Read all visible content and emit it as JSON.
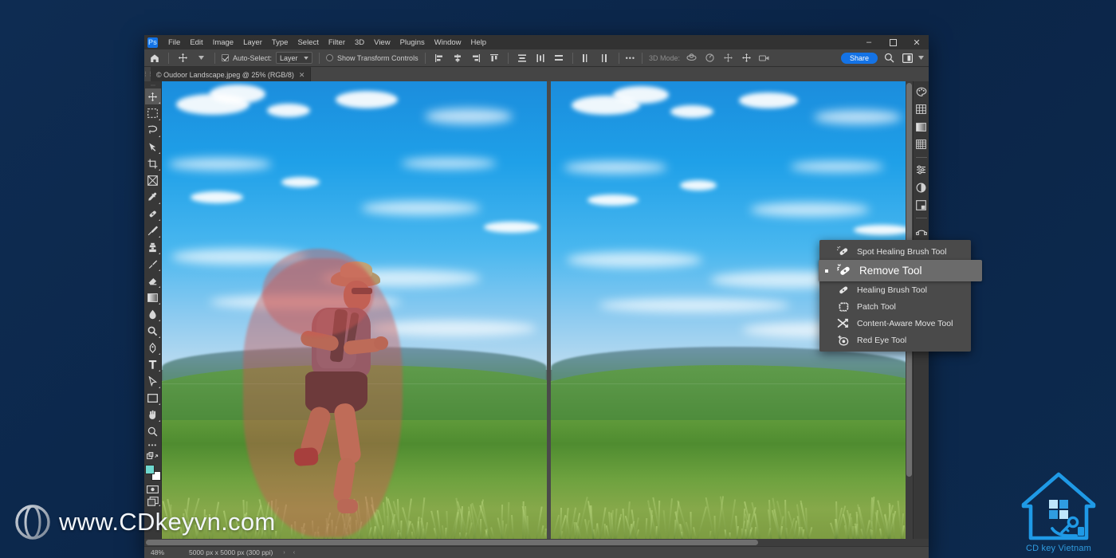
{
  "app": {
    "name": "Adobe Photoshop",
    "logo_text": "Ps"
  },
  "menubar": {
    "items": [
      "File",
      "Edit",
      "Image",
      "Layer",
      "Type",
      "Select",
      "Filter",
      "3D",
      "View",
      "Plugins",
      "Window",
      "Help"
    ],
    "window_controls": {
      "minimize": "–",
      "restore": "❐",
      "close": "✕"
    }
  },
  "optionsbar": {
    "home_icon": "home-icon",
    "tool_preset_icon": "move-tool-icon",
    "auto_select_label": "Auto-Select:",
    "auto_select_checked": true,
    "auto_select_value": "Layer",
    "show_transform_label": "Show Transform Controls",
    "show_transform_checked": false,
    "align_icons": [
      "align-left-edges",
      "align-horizontal-centers",
      "align-right-edges",
      "align-top-edges",
      "align-vertical-centers",
      "align-bottom-edges"
    ],
    "distribute_icons": [
      "distribute-vertical",
      "distribute-horizontal"
    ],
    "more_label": "•••",
    "mode_3d_label": "3D Mode:",
    "mode_3d_icons": [
      "orbit-3d",
      "roll-3d",
      "pan-3d",
      "slide-3d",
      "camera-3d"
    ],
    "share_label": "Share",
    "search_icon": "search-icon",
    "workspace_icon": "workspace-switcher-icon",
    "chevron_icon": "chevron-down-icon"
  },
  "document": {
    "tab_title": "© Oudoor Landscape.jpeg @ 25% (RGB/8)",
    "close_glyph": "✕"
  },
  "toolbar": {
    "items": [
      {
        "name": "move-tool",
        "glyph": "move",
        "active": true,
        "has_corner": true
      },
      {
        "name": "rectangular-marquee-tool",
        "glyph": "marquee",
        "has_corner": true
      },
      {
        "name": "lasso-tool",
        "glyph": "lasso",
        "has_corner": true
      },
      {
        "name": "object-selection-tool",
        "glyph": "magicwand",
        "has_corner": true
      },
      {
        "name": "crop-tool",
        "glyph": "crop",
        "has_corner": true
      },
      {
        "name": "frame-tool",
        "glyph": "frame",
        "has_corner": false
      },
      {
        "name": "eyedropper-tool",
        "glyph": "eyedropper",
        "has_corner": true
      },
      {
        "name": "spot-healing-brush-tool",
        "glyph": "healing",
        "has_corner": true
      },
      {
        "name": "brush-tool",
        "glyph": "brush",
        "has_corner": true
      },
      {
        "name": "clone-stamp-tool",
        "glyph": "stamp",
        "has_corner": true
      },
      {
        "name": "history-brush-tool",
        "glyph": "historybrush",
        "has_corner": true
      },
      {
        "name": "eraser-tool",
        "glyph": "eraser",
        "has_corner": true
      },
      {
        "name": "gradient-tool",
        "glyph": "gradient",
        "has_corner": true
      },
      {
        "name": "blur-tool",
        "glyph": "blur",
        "has_corner": true
      },
      {
        "name": "dodge-tool",
        "glyph": "dodge",
        "has_corner": true
      },
      {
        "name": "pen-tool",
        "glyph": "pen",
        "has_corner": true
      },
      {
        "name": "type-tool",
        "glyph": "type",
        "has_corner": true
      },
      {
        "name": "path-selection-tool",
        "glyph": "pathselect",
        "has_corner": true
      },
      {
        "name": "rectangle-tool",
        "glyph": "rectangle",
        "has_corner": true
      },
      {
        "name": "hand-tool",
        "glyph": "hand",
        "has_corner": true
      },
      {
        "name": "zoom-tool",
        "glyph": "zoom",
        "has_corner": false
      }
    ],
    "more_tools_label": "•••",
    "edit_toolbar_icon": "edit-toolbar-icon",
    "foreground_color": "#6fd9cf",
    "background_color": "#ffffff",
    "quick_mask_icon": "quick-mask-icon",
    "screen_mode_icon": "screen-mode-icon"
  },
  "right_dock": {
    "icons": [
      {
        "name": "color-panel-icon"
      },
      {
        "name": "swatches-panel-icon"
      },
      {
        "name": "gradients-panel-icon"
      },
      {
        "name": "patterns-panel-icon"
      },
      {
        "name": "adjustments-panel-icon"
      },
      {
        "name": "adjustment-layer-icon"
      },
      {
        "name": "libraries-panel-icon"
      },
      {
        "name": "paths-panel-icon"
      },
      {
        "name": "channels-panel-icon"
      },
      {
        "name": "layers-panel-icon"
      }
    ]
  },
  "flyout_menu": {
    "items": [
      {
        "label": "Spot Healing Brush Tool",
        "icon": "spot-healing-brush-icon",
        "selected": false
      },
      {
        "label": "Remove Tool",
        "icon": "remove-tool-icon",
        "selected": true
      },
      {
        "label": "Healing Brush Tool",
        "icon": "healing-brush-icon",
        "selected": false
      },
      {
        "label": "Patch Tool",
        "icon": "patch-tool-icon",
        "selected": false
      },
      {
        "label": "Content-Aware Move Tool",
        "icon": "content-aware-move-icon",
        "selected": false
      },
      {
        "label": "Red Eye Tool",
        "icon": "red-eye-tool-icon",
        "selected": false
      }
    ]
  },
  "statusbar": {
    "zoom_level": "48%",
    "doc_dimensions": "5000 px x 5000 px (300 ppi)",
    "next_arrow": "›",
    "prev_arrow": "‹"
  },
  "watermark": {
    "text": "www.CDkeyvn.com",
    "icon": "globe-icon"
  },
  "brand_logo": {
    "label": "CD key Vietnam",
    "icon": "house-windows-key-icon",
    "accent_color": "#1f9ae6"
  },
  "canvas": {
    "left_pane_caption": "original-photo-with-runner-selection",
    "right_pane_caption": "result-photo-runner-removed",
    "selection_overlay_color": "#d05550"
  },
  "colors": {
    "window_chrome": "#535353",
    "menubar_bg": "#323232",
    "panel_bg": "#383838",
    "canvas_bg": "#525252",
    "accent_blue": "#1473e6",
    "desktop_bg": "#0d2b50"
  }
}
